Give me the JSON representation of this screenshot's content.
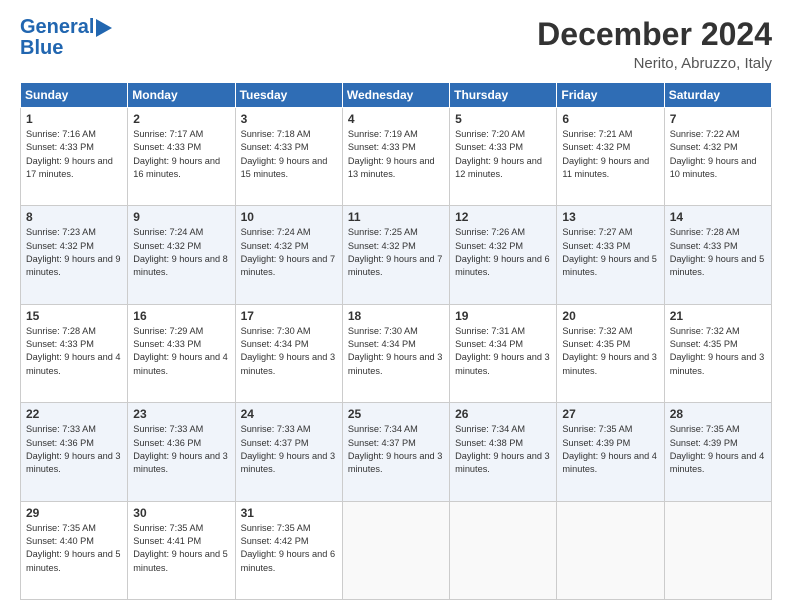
{
  "header": {
    "logo_line1": "General",
    "logo_line2": "Blue",
    "month_title": "December 2024",
    "location": "Nerito, Abruzzo, Italy"
  },
  "weekdays": [
    "Sunday",
    "Monday",
    "Tuesday",
    "Wednesday",
    "Thursday",
    "Friday",
    "Saturday"
  ],
  "weeks": [
    [
      {
        "day": "1",
        "sunrise": "7:16 AM",
        "sunset": "4:33 PM",
        "daylight": "9 hours and 17 minutes."
      },
      {
        "day": "2",
        "sunrise": "7:17 AM",
        "sunset": "4:33 PM",
        "daylight": "9 hours and 16 minutes."
      },
      {
        "day": "3",
        "sunrise": "7:18 AM",
        "sunset": "4:33 PM",
        "daylight": "9 hours and 15 minutes."
      },
      {
        "day": "4",
        "sunrise": "7:19 AM",
        "sunset": "4:33 PM",
        "daylight": "9 hours and 13 minutes."
      },
      {
        "day": "5",
        "sunrise": "7:20 AM",
        "sunset": "4:33 PM",
        "daylight": "9 hours and 12 minutes."
      },
      {
        "day": "6",
        "sunrise": "7:21 AM",
        "sunset": "4:32 PM",
        "daylight": "9 hours and 11 minutes."
      },
      {
        "day": "7",
        "sunrise": "7:22 AM",
        "sunset": "4:32 PM",
        "daylight": "9 hours and 10 minutes."
      }
    ],
    [
      {
        "day": "8",
        "sunrise": "7:23 AM",
        "sunset": "4:32 PM",
        "daylight": "9 hours and 9 minutes."
      },
      {
        "day": "9",
        "sunrise": "7:24 AM",
        "sunset": "4:32 PM",
        "daylight": "9 hours and 8 minutes."
      },
      {
        "day": "10",
        "sunrise": "7:24 AM",
        "sunset": "4:32 PM",
        "daylight": "9 hours and 7 minutes."
      },
      {
        "day": "11",
        "sunrise": "7:25 AM",
        "sunset": "4:32 PM",
        "daylight": "9 hours and 7 minutes."
      },
      {
        "day": "12",
        "sunrise": "7:26 AM",
        "sunset": "4:32 PM",
        "daylight": "9 hours and 6 minutes."
      },
      {
        "day": "13",
        "sunrise": "7:27 AM",
        "sunset": "4:33 PM",
        "daylight": "9 hours and 5 minutes."
      },
      {
        "day": "14",
        "sunrise": "7:28 AM",
        "sunset": "4:33 PM",
        "daylight": "9 hours and 5 minutes."
      }
    ],
    [
      {
        "day": "15",
        "sunrise": "7:28 AM",
        "sunset": "4:33 PM",
        "daylight": "9 hours and 4 minutes."
      },
      {
        "day": "16",
        "sunrise": "7:29 AM",
        "sunset": "4:33 PM",
        "daylight": "9 hours and 4 minutes."
      },
      {
        "day": "17",
        "sunrise": "7:30 AM",
        "sunset": "4:34 PM",
        "daylight": "9 hours and 3 minutes."
      },
      {
        "day": "18",
        "sunrise": "7:30 AM",
        "sunset": "4:34 PM",
        "daylight": "9 hours and 3 minutes."
      },
      {
        "day": "19",
        "sunrise": "7:31 AM",
        "sunset": "4:34 PM",
        "daylight": "9 hours and 3 minutes."
      },
      {
        "day": "20",
        "sunrise": "7:32 AM",
        "sunset": "4:35 PM",
        "daylight": "9 hours and 3 minutes."
      },
      {
        "day": "21",
        "sunrise": "7:32 AM",
        "sunset": "4:35 PM",
        "daylight": "9 hours and 3 minutes."
      }
    ],
    [
      {
        "day": "22",
        "sunrise": "7:33 AM",
        "sunset": "4:36 PM",
        "daylight": "9 hours and 3 minutes."
      },
      {
        "day": "23",
        "sunrise": "7:33 AM",
        "sunset": "4:36 PM",
        "daylight": "9 hours and 3 minutes."
      },
      {
        "day": "24",
        "sunrise": "7:33 AM",
        "sunset": "4:37 PM",
        "daylight": "9 hours and 3 minutes."
      },
      {
        "day": "25",
        "sunrise": "7:34 AM",
        "sunset": "4:37 PM",
        "daylight": "9 hours and 3 minutes."
      },
      {
        "day": "26",
        "sunrise": "7:34 AM",
        "sunset": "4:38 PM",
        "daylight": "9 hours and 3 minutes."
      },
      {
        "day": "27",
        "sunrise": "7:35 AM",
        "sunset": "4:39 PM",
        "daylight": "9 hours and 4 minutes."
      },
      {
        "day": "28",
        "sunrise": "7:35 AM",
        "sunset": "4:39 PM",
        "daylight": "9 hours and 4 minutes."
      }
    ],
    [
      {
        "day": "29",
        "sunrise": "7:35 AM",
        "sunset": "4:40 PM",
        "daylight": "9 hours and 5 minutes."
      },
      {
        "day": "30",
        "sunrise": "7:35 AM",
        "sunset": "4:41 PM",
        "daylight": "9 hours and 5 minutes."
      },
      {
        "day": "31",
        "sunrise": "7:35 AM",
        "sunset": "4:42 PM",
        "daylight": "9 hours and 6 minutes."
      },
      null,
      null,
      null,
      null
    ]
  ],
  "labels": {
    "sunrise": "Sunrise:",
    "sunset": "Sunset:",
    "daylight": "Daylight:"
  }
}
